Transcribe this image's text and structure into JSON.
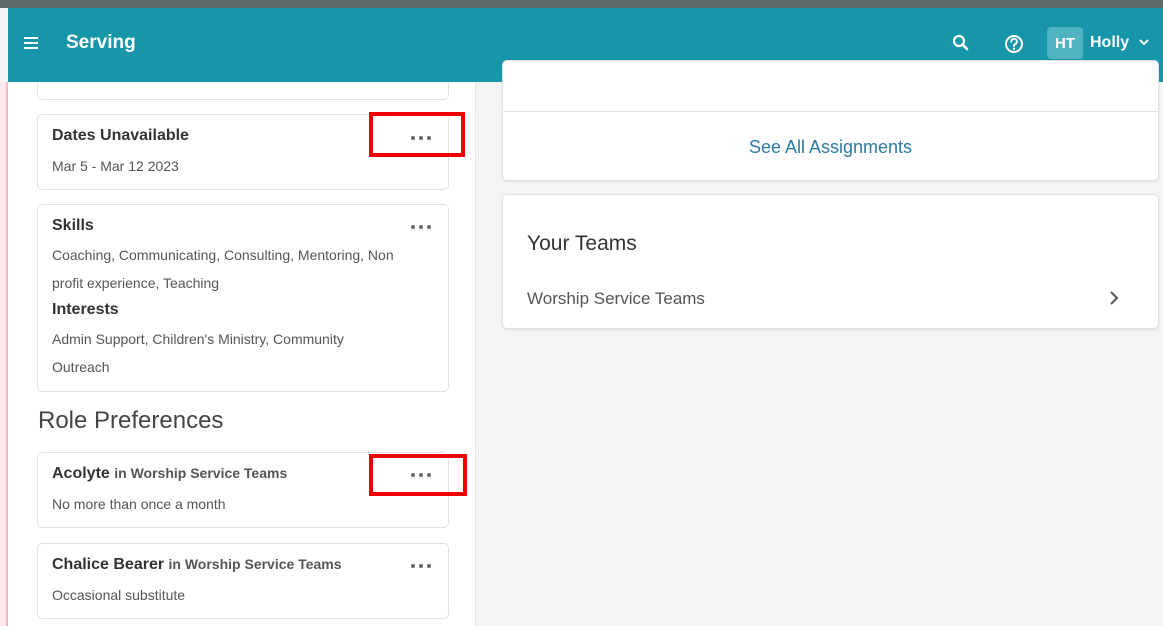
{
  "header": {
    "title": "Serving",
    "user_initials": "HT",
    "user_name": "Holly"
  },
  "left": {
    "dates_unavailable": {
      "title": "Dates Unavailable",
      "range": "Mar 5 - Mar 12 2023"
    },
    "skills": {
      "title": "Skills",
      "line1": "Coaching, Communicating, Consulting, Mentoring, Non",
      "line2": "profit experience, Teaching",
      "interests_title": "Interests",
      "interests_line1": "Admin Support, Children's Ministry, Community",
      "interests_line2": "Outreach"
    },
    "role_preferences_heading": "Role Preferences",
    "roles": [
      {
        "role": "Acolyte",
        "team": "in Worship Service Teams",
        "frequency": "No more than once a month"
      },
      {
        "role": "Chalice Bearer",
        "team": "in Worship Service Teams",
        "frequency": "Occasional substitute"
      }
    ]
  },
  "right": {
    "see_all_assignments": "See All Assignments",
    "your_teams": {
      "title": "Your Teams",
      "items": [
        "Worship Service Teams"
      ]
    }
  },
  "colors": {
    "header_bg": "#1696a8",
    "link": "#2a7aa2",
    "highlight": "#ee0000"
  },
  "icons": [
    "menu-icon",
    "search-icon",
    "help-icon",
    "chevron-down-icon",
    "more-icon",
    "chevron-right-icon"
  ]
}
